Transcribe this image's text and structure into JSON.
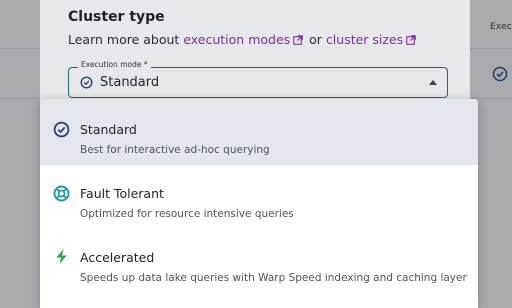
{
  "background": {
    "column_header": "Exec"
  },
  "dialog": {
    "title": "Cluster type",
    "intro_text": "Learn more about",
    "link_execution_modes": "execution modes",
    "conjunction": "or",
    "link_cluster_sizes": "cluster sizes",
    "field": {
      "label": "Execution mode *",
      "value": "Standard"
    }
  },
  "menu": {
    "options": [
      {
        "title": "Standard",
        "description": "Best for interactive ad-hoc querying",
        "icon": "check-circle-icon",
        "selected": true
      },
      {
        "title": "Fault Tolerant",
        "description": "Optimized for resource intensive queries",
        "icon": "lifebuoy-icon",
        "selected": false
      },
      {
        "title": "Accelerated",
        "description": "Speeds up data lake queries with Warp Speed indexing and caching layer",
        "icon": "lightning-icon",
        "selected": false
      }
    ]
  },
  "colors": {
    "link": "#7a2ea0",
    "field_border": "#1f6a6c",
    "icon_navy": "#1e3a6e",
    "icon_teal": "#1f9a9a",
    "icon_green": "#2fa84f"
  }
}
